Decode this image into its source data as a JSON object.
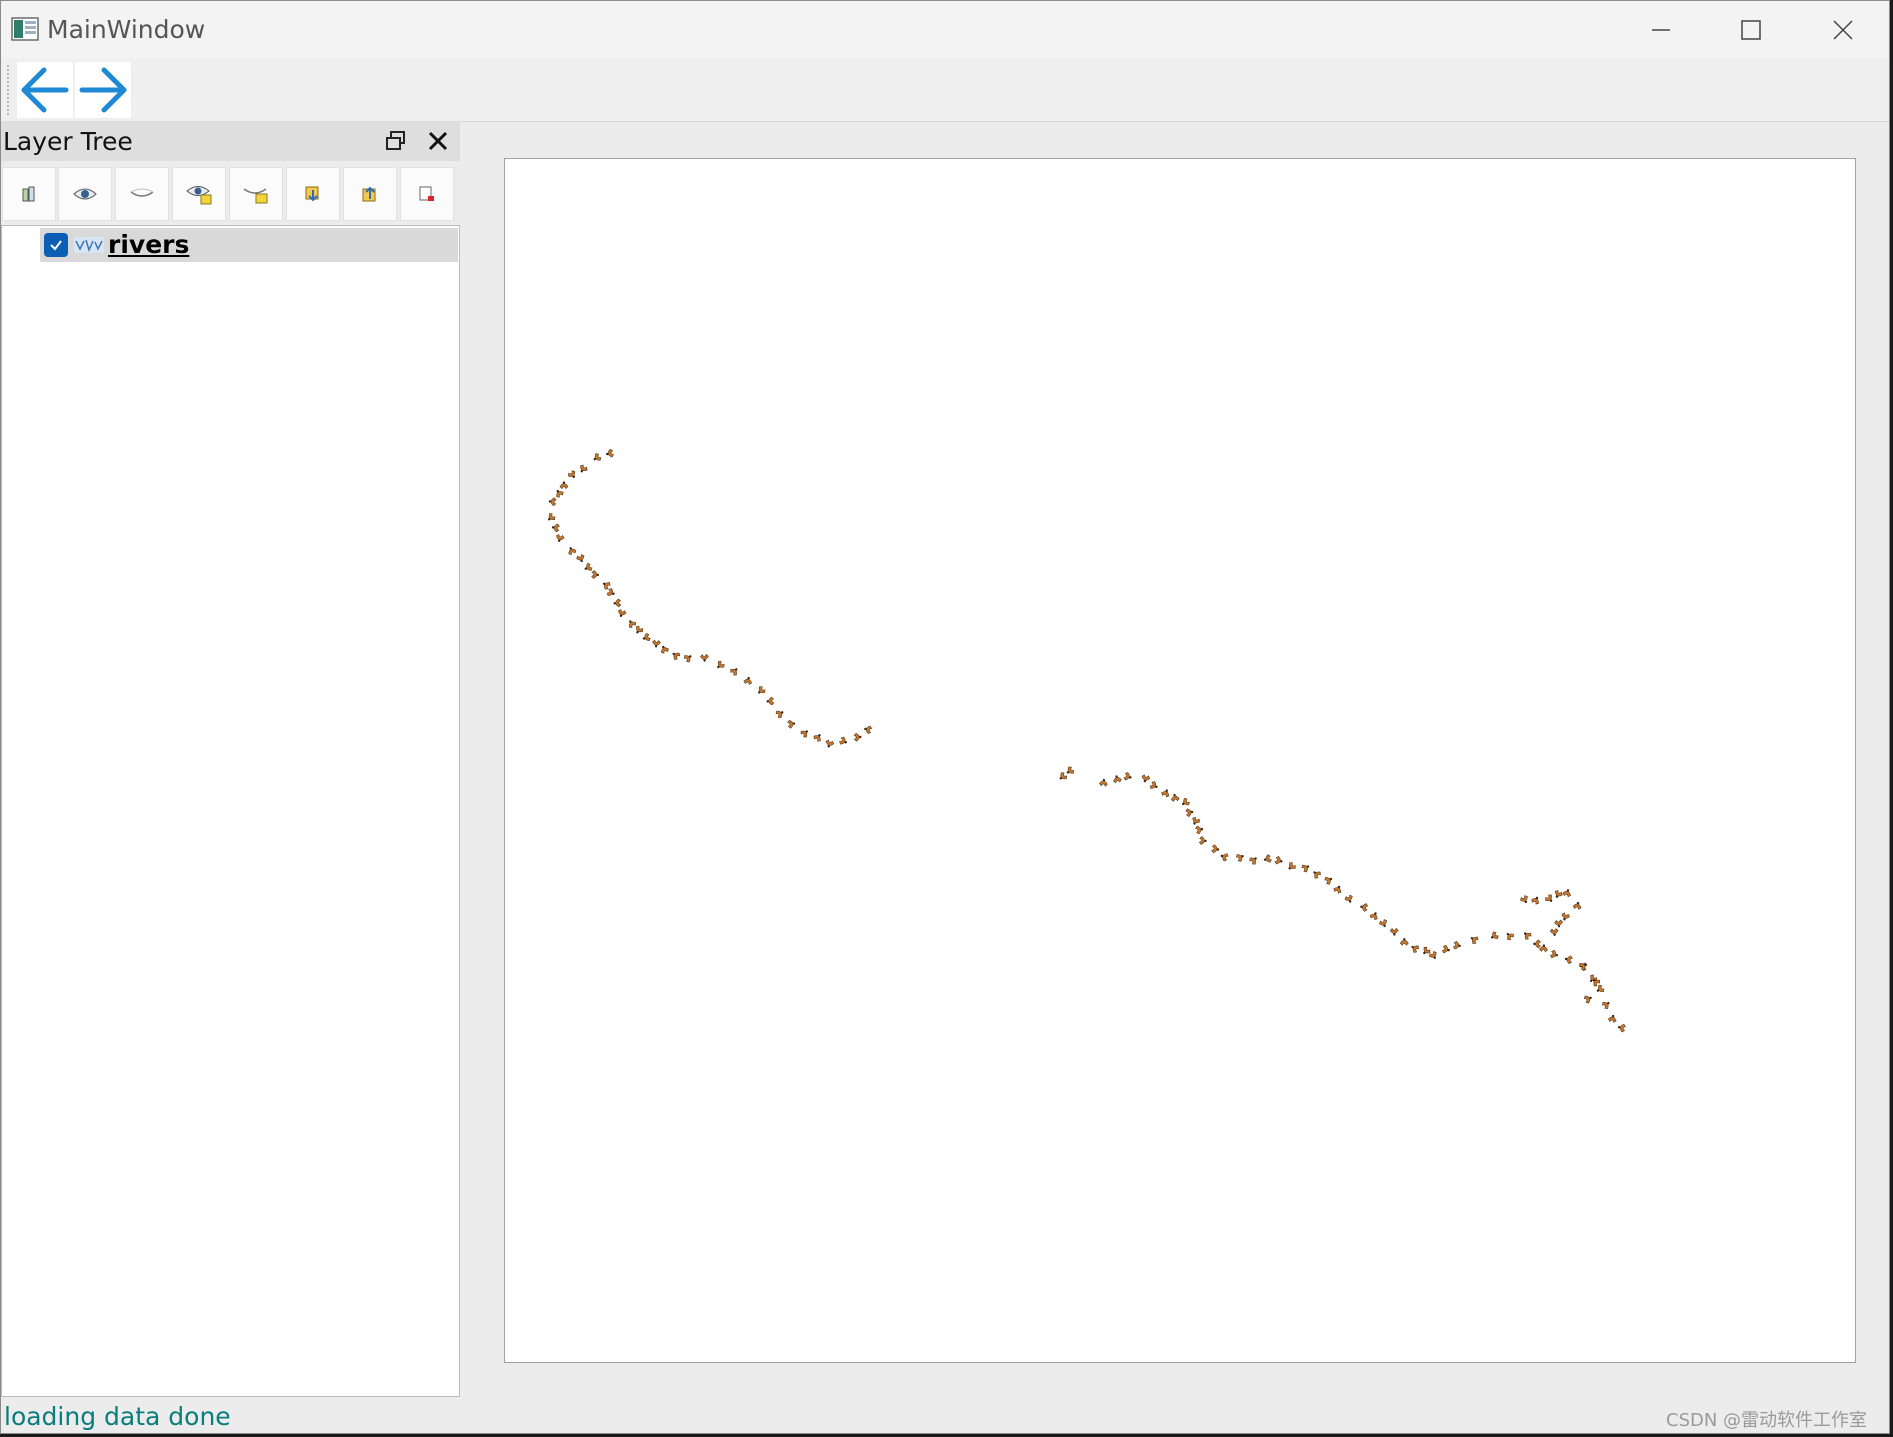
{
  "window": {
    "title": "MainWindow",
    "minimize_icon": "minimize-icon",
    "maximize_icon": "maximize-icon",
    "close_icon": "close-icon"
  },
  "toolbar": {
    "back_icon": "arrow-left-icon",
    "forward_icon": "arrow-right-icon",
    "accent_color": "#1e8ad6"
  },
  "layer_tree": {
    "title": "Layer Tree",
    "tools": [
      {
        "icon": "add-group-icon"
      },
      {
        "icon": "show-all-icon"
      },
      {
        "icon": "hide-all-icon"
      },
      {
        "icon": "show-selected-icon"
      },
      {
        "icon": "hide-selected-icon"
      },
      {
        "icon": "move-down-icon"
      },
      {
        "icon": "move-up-icon"
      },
      {
        "icon": "remove-layer-icon"
      }
    ],
    "layers": [
      {
        "name": "rivers",
        "checked": true,
        "icon": "line-layer-icon"
      }
    ]
  },
  "map": {
    "layer": "rivers",
    "symbol_color": "#c8782f",
    "background": "#ffffff"
  },
  "status": {
    "message": "loading data done"
  },
  "watermark": "CSDN @雷动软件工作室"
}
